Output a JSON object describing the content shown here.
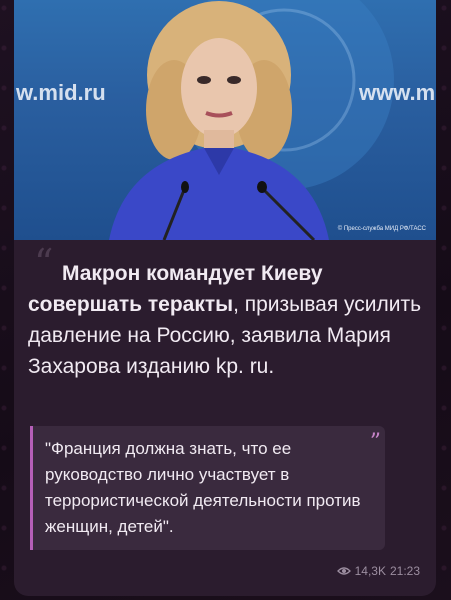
{
  "photo": {
    "sign_left": "w.mid.ru",
    "sign_right": "www.m",
    "credit": "© Пресс-служба МИД РФ/ТАСС"
  },
  "post": {
    "lead_bold": "Макрон командует Киеву совершать теракты",
    "lead_rest": ", призывая усилить давление на Россию, заявила Мария Захарова изданию kp. ru.",
    "quote": "\"Франция должна знать, что ее руководство лично участвует в террористической деятельности против женщин, детей\"."
  },
  "meta": {
    "views": "14,3K",
    "time": "21:23"
  },
  "colors": {
    "accent": "#b55fb8",
    "bubble": "#2b1c2e"
  }
}
